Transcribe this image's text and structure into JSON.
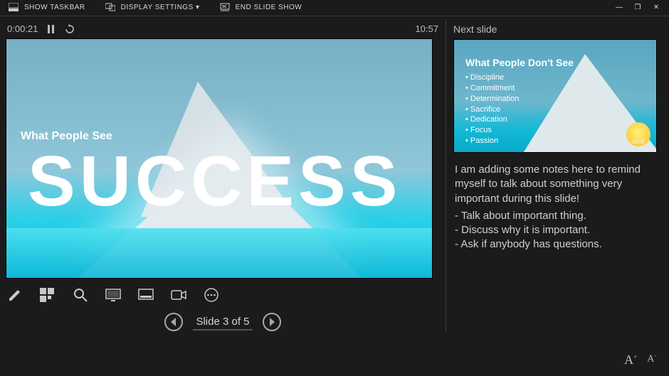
{
  "topbar": {
    "show_taskbar": "SHOW TASKBAR",
    "display_settings": "DISPLAY SETTINGS ▾",
    "end_show": "END SLIDE SHOW"
  },
  "timer": {
    "elapsed": "0:00:21",
    "clock": "10:57"
  },
  "current_slide": {
    "subhead": "What People See",
    "headline": "SUCCESS"
  },
  "nav": {
    "label": "Slide 3 of 5"
  },
  "next": {
    "label": "Next slide",
    "title": "What People Don't See",
    "bullets": [
      "Discipline",
      "Commitment",
      "Determination",
      "Sacrifice",
      "Dedication",
      "Focus",
      "Passion"
    ]
  },
  "notes": {
    "intro": "I am adding some notes here to remind myself to talk about something very important during this slide!",
    "points": [
      "Talk about important thing.",
      "Discuss why it is important.",
      "Ask if anybody has questions."
    ]
  },
  "fontsize": {
    "increase": "A",
    "decrease": "A",
    "inc_sup": "+",
    "dec_sup": "-"
  }
}
